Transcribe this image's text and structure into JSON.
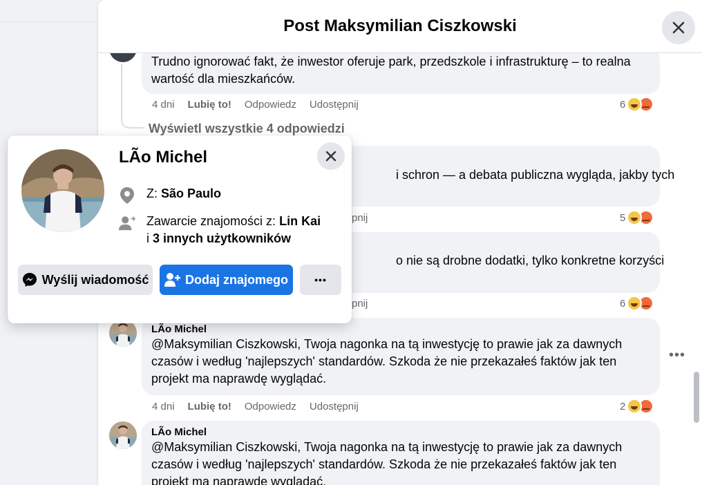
{
  "modal": {
    "title": "Post Maksymilian Ciszkowski"
  },
  "comments": [
    {
      "text": "Trudno ignorować fakt, że inwestor oferuje park, przedszkole i infrastrukturę – to realna wartość dla mieszkańców.",
      "time": "4 dni",
      "like": "Lubię to!",
      "reply": "Odpowiedz",
      "share": "Udostępnij",
      "reactions": "6"
    },
    {
      "more_replies": "Wyświetl wszystkie 4 odpowiedzi"
    },
    {
      "text": "i schron — a debata publiczna wygląda, jakby tych",
      "share_partial": "pnij",
      "reactions": "5"
    },
    {
      "text": "o nie są drobne dodatki, tylko konkretne korzyści",
      "share_partial": "pnij",
      "reactions": "6"
    },
    {
      "author": "LÃo Michel",
      "text": "@Maksymilian Ciszkowski, Twoja nagonka na tą inwestycję to prawie jak za dawnych czasów i według 'najlepszych' standardów. Szkoda że nie przekazałeś faktów jak ten projekt ma naprawdę wyglądać.",
      "time": "4 dni",
      "like": "Lubię to!",
      "reply": "Odpowiedz",
      "share": "Udostępnij",
      "reactions": "2"
    },
    {
      "author": "LÃo Michel",
      "text": "@Maksymilian Ciszkowski, Twoja nagonka na tą inwestycję to prawie jak za dawnych czasów i według 'najlepszych' standardów. Szkoda że nie przekazałeś faktów jak ten projekt ma naprawdę wyglądać."
    }
  ],
  "profile_card": {
    "name": "LÃo Michel",
    "location_prefix": "Z:",
    "location": "São Paulo",
    "friends_prefix": "Zawarcie znajomości z:",
    "friend_name": "Lin Kai",
    "friends_and": "i",
    "friends_others": "3 innych użytkowników",
    "message_button": "Wyślij wiadomość",
    "add_friend_button": "Dodaj znajomego",
    "more_button": "•••"
  },
  "side_more": "•••",
  "colors": {
    "accent": "#1b74e4",
    "haha": "#f7c54a",
    "angry": "#f26a3a"
  }
}
